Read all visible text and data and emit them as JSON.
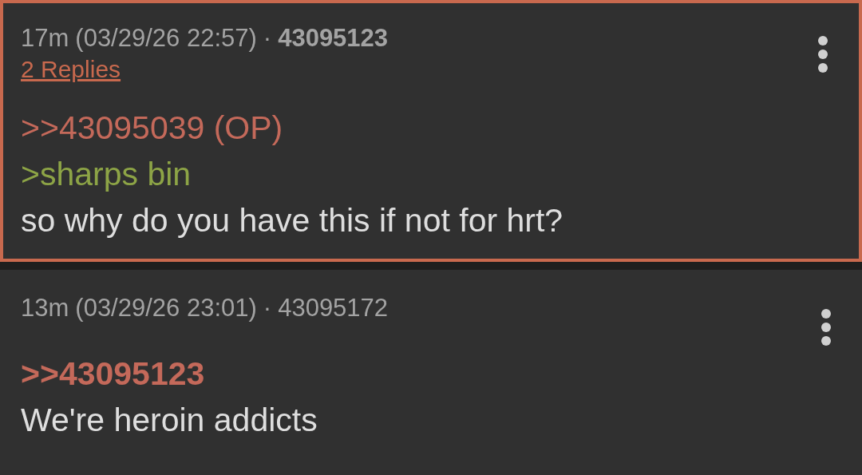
{
  "posts": [
    {
      "ago": "17m",
      "date": "(03/29/26 22:57)",
      "separator": "·",
      "number": "43095123",
      "highlighted": true,
      "replies": "2 Replies",
      "lines": [
        {
          "kind": "quote",
          "text": ">>43095039 (OP)",
          "emphasized": false
        },
        {
          "kind": "greentext",
          "text": ">sharps bin"
        },
        {
          "kind": "text",
          "text": "so why do you have this if not for hrt?"
        }
      ]
    },
    {
      "ago": "13m",
      "date": "(03/29/26 23:01)",
      "separator": "·",
      "number": "43095172",
      "highlighted": false,
      "lines": [
        {
          "kind": "quote",
          "text": ">>43095123",
          "emphasized": true
        },
        {
          "kind": "text",
          "text": "We're heroin addicts"
        }
      ]
    }
  ]
}
